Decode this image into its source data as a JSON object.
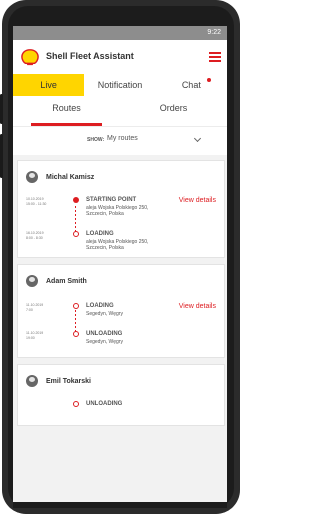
{
  "app": {
    "title": "Shell Fleet Assistant",
    "brand_color": "#dd1d21",
    "accent_color": "#ffd500"
  },
  "statusbar": {
    "time": "9:22"
  },
  "tabs": [
    {
      "label": "Live",
      "active": true
    },
    {
      "label": "Notification",
      "active": false
    },
    {
      "label": "Chat",
      "active": false,
      "has_badge": true
    }
  ],
  "subtabs": [
    {
      "label": "Routes",
      "active": true
    },
    {
      "label": "Orders",
      "active": false
    }
  ],
  "filter": {
    "label": "SHOW:",
    "value": "My routes"
  },
  "routes": [
    {
      "driver": "Michal Kamisz",
      "view_details": "View details",
      "stops": [
        {
          "date": "10.10.2019",
          "time": "15:00 - 11:30",
          "type": "STARTING POINT",
          "address": "aleja Wojska Polskiego 250, Szczecin, Polska",
          "marker": "filled"
        },
        {
          "date": "16.10.2019",
          "time": "8:00 - 8:30",
          "type": "LOADING",
          "address": "aleja Wojska Polskiego 250, Szczecin, Polska",
          "marker": "open"
        }
      ]
    },
    {
      "driver": "Adam Smith",
      "view_details": "View details",
      "stops": [
        {
          "date": "11.10.2019",
          "time": "7:00",
          "type": "LOADING",
          "address": "Segedyn, Węgry",
          "marker": "open"
        },
        {
          "date": "11.10.2019",
          "time": "19:00",
          "type": "UNLOADING",
          "address": "Segedyn, Węgry",
          "marker": "open"
        }
      ]
    },
    {
      "driver": "Emil Tokarski",
      "stops": [
        {
          "type": "UNLOADING"
        }
      ]
    }
  ]
}
